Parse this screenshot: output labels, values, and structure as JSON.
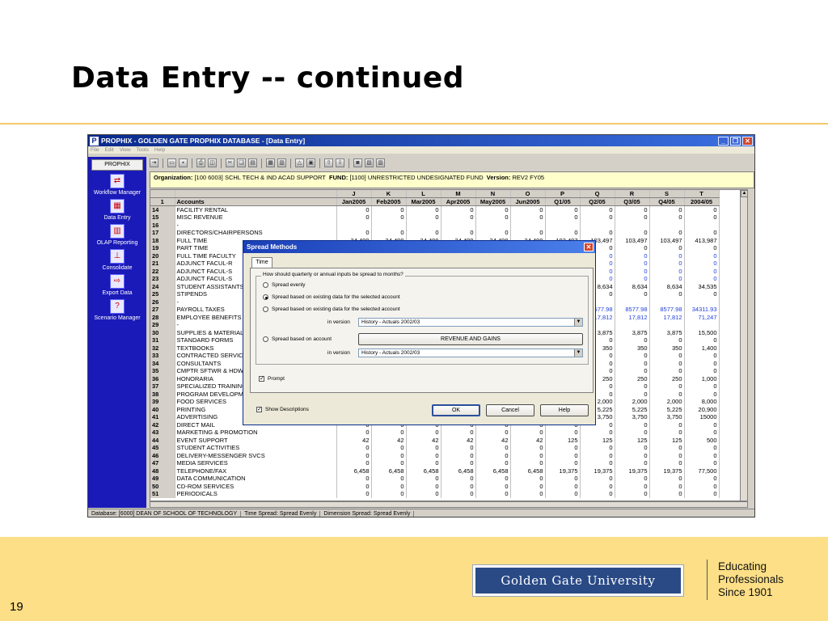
{
  "slide": {
    "title": "Data Entry -- continued",
    "page_number": "19",
    "brand_logo_text": "Golden Gate University",
    "tagline": [
      "Educating",
      "Professionals",
      "Since 1901"
    ]
  },
  "window": {
    "title": "PROPHIX - GOLDEN GATE PROPHIX DATABASE - [Data Entry]",
    "menu": [
      "File",
      "Edit",
      "View",
      "Tools",
      "Help"
    ]
  },
  "nav": {
    "header": "PROPHIX",
    "items": [
      {
        "label": "Workflow Manager",
        "icon": "workflow-icon"
      },
      {
        "label": "Data Entry",
        "icon": "data-entry-icon"
      },
      {
        "label": "OLAP Reporting",
        "icon": "olap-reporting-icon"
      },
      {
        "label": "Consolidate",
        "icon": "consolidate-icon"
      },
      {
        "label": "Export Data",
        "icon": "export-data-icon"
      },
      {
        "label": "Scenario Manager",
        "icon": "scenario-manager-icon"
      }
    ]
  },
  "infobar": {
    "org_label": "Organization:",
    "org_value": "[100 6003] SCHL TECH & IND ACAD SUPPORT",
    "fund_label": "FUND:",
    "fund_value": "[1100] UNRESTRICTED UNDESIGNATED FUND",
    "version_label": "Version:",
    "version_value": "REV2 FY05"
  },
  "grid": {
    "col_letters": [
      "J",
      "K",
      "L",
      "M",
      "N",
      "O",
      "P",
      "Q",
      "R",
      "S",
      "T"
    ],
    "header_row_num": "1",
    "accounts_header": "Accounts",
    "col_headers": [
      "Jan2005",
      "Feb2005",
      "Mar2005",
      "Apr2005",
      "May2005",
      "Jun2005",
      "Q1/05",
      "Q2/05",
      "Q3/05",
      "Q4/05",
      "2004/05"
    ],
    "rows": [
      {
        "n": "14",
        "a": "FACILITY RENTAL",
        "v": [
          "0",
          "0",
          "0",
          "0",
          "0",
          "0",
          "0",
          "0",
          "0",
          "0",
          "0"
        ]
      },
      {
        "n": "15",
        "a": "MISC REVENUE",
        "v": [
          "0",
          "0",
          "0",
          "0",
          "0",
          "0",
          "0",
          "0",
          "0",
          "0",
          "0"
        ]
      },
      {
        "n": "16",
        "a": "-",
        "v": [
          "",
          "",
          "",
          "",
          "",
          "",
          "",
          "",
          "",
          "",
          ""
        ]
      },
      {
        "n": "17",
        "a": "DIRECTORS/CHAIRPERSONS",
        "v": [
          "0",
          "0",
          "0",
          "0",
          "0",
          "0",
          "0",
          "0",
          "0",
          "0",
          "0"
        ]
      },
      {
        "n": "18",
        "a": "FULL TIME",
        "v": [
          "34,499",
          "34,499",
          "34,499",
          "34,499",
          "34,499",
          "34,499",
          "103,497",
          "103,497",
          "103,497",
          "103,497",
          "413,987"
        ]
      },
      {
        "n": "19",
        "a": "PART TIME",
        "v": [
          "",
          "",
          "",
          "",
          "",
          "",
          "",
          "0",
          "0",
          "0",
          "0"
        ]
      },
      {
        "n": "20",
        "a": "FULL TIME FACULTY",
        "v": [
          "",
          "",
          "",
          "",
          "",
          "",
          "",
          "0",
          "0",
          "0",
          "0"
        ],
        "blue": true
      },
      {
        "n": "21",
        "a": "ADJUNCT FACUL-R",
        "v": [
          "",
          "",
          "",
          "",
          "",
          "",
          "",
          "0",
          "0",
          "0",
          "0"
        ],
        "blue": true
      },
      {
        "n": "22",
        "a": "ADJUNCT FACUL-S",
        "v": [
          "",
          "",
          "",
          "",
          "",
          "",
          "",
          "0",
          "0",
          "0",
          "0"
        ],
        "blue": true
      },
      {
        "n": "23",
        "a": "ADJUNCT FACUL-S",
        "v": [
          "",
          "",
          "",
          "",
          "",
          "",
          "",
          "0",
          "0",
          "0",
          "0"
        ],
        "blue": true
      },
      {
        "n": "24",
        "a": "STUDENT ASSISTANTS",
        "v": [
          "",
          "",
          "",
          "",
          "",
          "",
          "",
          "8,634",
          "8,634",
          "8,634",
          "34,535"
        ]
      },
      {
        "n": "25",
        "a": "STIPENDS",
        "v": [
          "",
          "",
          "",
          "",
          "",
          "",
          "",
          "0",
          "0",
          "0",
          "0"
        ]
      },
      {
        "n": "26",
        "a": "-",
        "v": [
          "",
          "",
          "",
          "",
          "",
          "",
          "",
          "",
          "",
          "",
          ""
        ]
      },
      {
        "n": "27",
        "a": "PAYROLL TAXES",
        "v": [
          "",
          "",
          "",
          "",
          "",
          "",
          "",
          "8577.98",
          "8577.98",
          "8577.98",
          "34311.93"
        ],
        "blue": true
      },
      {
        "n": "28",
        "a": "EMPLOYEE BENEFITS",
        "v": [
          "",
          "",
          "",
          "",
          "",
          "",
          "",
          "17,812",
          "17,812",
          "17,812",
          "71,247"
        ],
        "blue": true
      },
      {
        "n": "29",
        "a": "-",
        "v": [
          "",
          "",
          "",
          "",
          "",
          "",
          "",
          "",
          "",
          "",
          ""
        ]
      },
      {
        "n": "30",
        "a": "SUPPLIES & MATERIALS",
        "v": [
          "",
          "",
          "",
          "",
          "",
          "",
          "",
          "3,875",
          "3,875",
          "3,875",
          "15,500"
        ]
      },
      {
        "n": "31",
        "a": "STANDARD FORMS",
        "v": [
          "",
          "",
          "",
          "",
          "",
          "",
          "",
          "0",
          "0",
          "0",
          "0"
        ]
      },
      {
        "n": "32",
        "a": "TEXTBOOKS",
        "v": [
          "",
          "",
          "",
          "",
          "",
          "",
          "",
          "350",
          "350",
          "350",
          "1,400"
        ]
      },
      {
        "n": "33",
        "a": "CONTRACTED SERVICES",
        "v": [
          "",
          "",
          "",
          "",
          "",
          "",
          "",
          "0",
          "0",
          "0",
          "0"
        ]
      },
      {
        "n": "34",
        "a": "CONSULTANTS",
        "v": [
          "",
          "",
          "",
          "",
          "",
          "",
          "",
          "0",
          "0",
          "0",
          "0"
        ]
      },
      {
        "n": "35",
        "a": "CMPTR SFTWR & HDWR",
        "v": [
          "",
          "",
          "",
          "",
          "",
          "",
          "",
          "0",
          "0",
          "0",
          "0"
        ]
      },
      {
        "n": "36",
        "a": "HONORARIA",
        "v": [
          "",
          "",
          "",
          "",
          "",
          "",
          "",
          "250",
          "250",
          "250",
          "1,000"
        ]
      },
      {
        "n": "37",
        "a": "SPECIALIZED TRAINING",
        "v": [
          "",
          "",
          "",
          "",
          "",
          "",
          "",
          "0",
          "0",
          "0",
          "0"
        ]
      },
      {
        "n": "38",
        "a": "PROGRAM DEVELOPMENT",
        "v": [
          "",
          "",
          "",
          "",
          "",
          "",
          "",
          "0",
          "0",
          "0",
          "0"
        ]
      },
      {
        "n": "39",
        "a": "FOOD SERVICES",
        "v": [
          "",
          "",
          "",
          "",
          "",
          "",
          "",
          "2,000",
          "2,000",
          "2,000",
          "8,000"
        ]
      },
      {
        "n": "40",
        "a": "PRINTING",
        "v": [
          "",
          "",
          "",
          "",
          "",
          "",
          "",
          "5,225",
          "5,225",
          "5,225",
          "20,900"
        ]
      },
      {
        "n": "41",
        "a": "ADVERTISING",
        "v": [
          "",
          "",
          "",
          "",
          "",
          "",
          "",
          "3,750",
          "3,750",
          "3,750",
          "15000"
        ]
      },
      {
        "n": "42",
        "a": "DIRECT MAIL",
        "v": [
          "0",
          "0",
          "0",
          "0",
          "0",
          "0",
          "0",
          "0",
          "0",
          "0",
          "0"
        ]
      },
      {
        "n": "43",
        "a": "MARKETING & PROMOTION",
        "v": [
          "0",
          "0",
          "0",
          "0",
          "0",
          "0",
          "0",
          "0",
          "0",
          "0",
          "0"
        ]
      },
      {
        "n": "44",
        "a": "EVENT SUPPORT",
        "v": [
          "42",
          "42",
          "42",
          "42",
          "42",
          "42",
          "125",
          "125",
          "125",
          "125",
          "500"
        ]
      },
      {
        "n": "45",
        "a": "STUDENT ACTIVITIES",
        "v": [
          "0",
          "0",
          "0",
          "0",
          "0",
          "0",
          "0",
          "0",
          "0",
          "0",
          "0"
        ]
      },
      {
        "n": "46",
        "a": "DELIVERY-MESSENGER SVCS",
        "v": [
          "0",
          "0",
          "0",
          "0",
          "0",
          "0",
          "0",
          "0",
          "0",
          "0",
          "0"
        ]
      },
      {
        "n": "47",
        "a": "MEDIA SERVICES",
        "v": [
          "0",
          "0",
          "0",
          "0",
          "0",
          "0",
          "0",
          "0",
          "0",
          "0",
          "0"
        ]
      },
      {
        "n": "48",
        "a": "TELEPHONE/FAX",
        "v": [
          "6,458",
          "6,458",
          "6,458",
          "6,458",
          "6,458",
          "6,458",
          "19,375",
          "19,375",
          "19,375",
          "19,375",
          "77,500"
        ]
      },
      {
        "n": "49",
        "a": "DATA COMMUNICATION",
        "v": [
          "0",
          "0",
          "0",
          "0",
          "0",
          "0",
          "0",
          "0",
          "0",
          "0",
          "0"
        ]
      },
      {
        "n": "50",
        "a": "CD-ROM SERVICES",
        "v": [
          "0",
          "0",
          "0",
          "0",
          "0",
          "0",
          "0",
          "0",
          "0",
          "0",
          "0"
        ]
      },
      {
        "n": "51",
        "a": "PERIODICALS",
        "v": [
          "0",
          "0",
          "0",
          "0",
          "0",
          "0",
          "0",
          "0",
          "0",
          "0",
          "0"
        ]
      }
    ]
  },
  "status": {
    "database": "Database: [6000] DEAN OF SCHOOL OF TECHNOLOGY",
    "time_spread": "Time Spread: Spread Evenly",
    "dimension_spread": "Dimension Spread: Spread Evenly"
  },
  "dialog": {
    "title": "Spread Methods",
    "tab": "Time",
    "group_legend": "How should quarterly or annual inputs be spread to months?",
    "opt_evenly": "Spread evenly",
    "opt_existing_selected": "Spread based on existing data for the selected account",
    "opt_existing_selected_2": "Spread based on existing data for the selected account",
    "in_version_label": "in version",
    "version_combo_1": "History - Actuals 2002/03",
    "opt_on_account": "Spread based on account",
    "account_button": "REVENUE AND GAINS",
    "in_version_label_2": "in version",
    "version_combo_2": "History - Actuals 2002/03",
    "prompt_label": "Prompt",
    "show_descriptions_label": "Show Descriptions",
    "ok": "OK",
    "cancel": "Cancel",
    "help": "Help"
  }
}
